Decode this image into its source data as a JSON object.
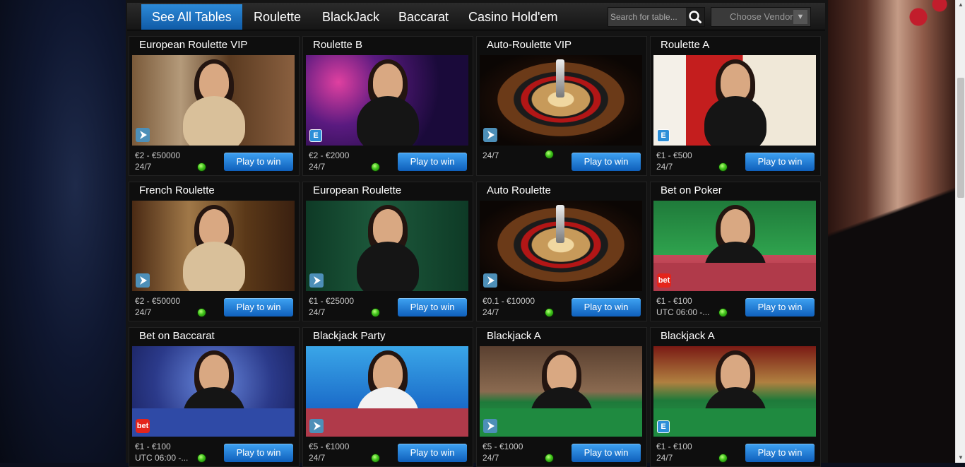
{
  "nav": {
    "tabs": [
      {
        "label": "See All Tables",
        "active": true
      },
      {
        "label": "Roulette",
        "active": false
      },
      {
        "label": "BlackJack",
        "active": false
      },
      {
        "label": "Baccarat",
        "active": false
      },
      {
        "label": "Casino Hold'em",
        "active": false
      }
    ],
    "search_placeholder": "Search for table...",
    "vendor_label": "Choose Vendor",
    "vendor_caret": "▼"
  },
  "play_label": "Play to win",
  "colors": {
    "accent": "#1f7ad0",
    "status_online": "#3fc31a"
  },
  "tables": [
    {
      "title": "European Roulette VIP",
      "limits": "€2 - €50000",
      "hours": "24/7",
      "badge": "play-icon"
    },
    {
      "title": "Roulette B",
      "limits": "€2 - €2000",
      "hours": "24/7",
      "badge": "e-icon"
    },
    {
      "title": "Auto-Roulette VIP",
      "limits": "",
      "hours": "24/7",
      "badge": "play-icon"
    },
    {
      "title": "Roulette A",
      "limits": "€1 - €500",
      "hours": "24/7",
      "badge": "e-icon"
    },
    {
      "title": "French Roulette",
      "limits": "€2 - €50000",
      "hours": "24/7",
      "badge": "play-icon"
    },
    {
      "title": "European Roulette",
      "limits": "€1 - €25000",
      "hours": "24/7",
      "badge": "play-icon"
    },
    {
      "title": "Auto Roulette",
      "limits": "€0.1 - €10000",
      "hours": "24/7",
      "badge": "play-icon"
    },
    {
      "title": "Bet on Poker",
      "limits": "€1 - €100",
      "hours": "UTC 06:00 -...",
      "badge": "bet-icon"
    },
    {
      "title": "Bet on Baccarat",
      "limits": "€1 - €100",
      "hours": "UTC 06:00 -...",
      "badge": "bet-icon"
    },
    {
      "title": "Blackjack Party",
      "limits": "€5 - €1000",
      "hours": "24/7",
      "badge": "play-icon"
    },
    {
      "title": "Blackjack A",
      "limits": "€5 - €1000",
      "hours": "24/7",
      "badge": "play-icon"
    },
    {
      "title": "Blackjack A",
      "limits": "€1 - €100",
      "hours": "24/7",
      "badge": "e-icon"
    }
  ],
  "badge_text": {
    "e": "E",
    "bet": "bet"
  }
}
